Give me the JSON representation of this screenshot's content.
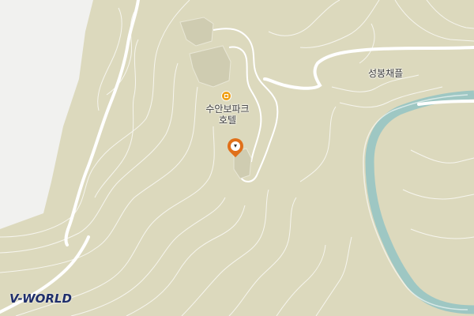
{
  "map": {
    "poi": {
      "name_line1": "수안보파크",
      "name_line2": "호텔",
      "icon": "hotel-icon"
    },
    "places": [
      {
        "label": "성봉채플"
      }
    ],
    "marker": {
      "icon": "location-pin-icon",
      "glyph": "▾"
    },
    "logo": "V-WORLD",
    "colors": {
      "terrain": "#dcd9bd",
      "contour": "#ffffff",
      "no_data": "#efefef",
      "river": "#9ec7c3",
      "road": "#ffffff",
      "marker": "#e0701a",
      "poi_icon": "#f0a21a"
    }
  }
}
